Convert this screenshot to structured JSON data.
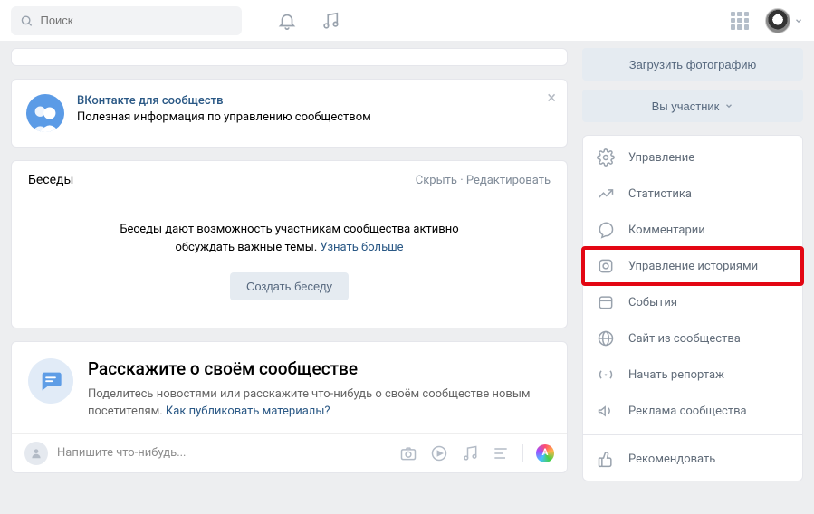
{
  "header": {
    "search_placeholder": "Поиск"
  },
  "info": {
    "title": "ВКонтакте для сообществ",
    "desc": "Полезная информация по управлению сообществом"
  },
  "chats": {
    "title": "Беседы",
    "hide": "Скрыть",
    "edit": "Редактировать",
    "body_line1": "Беседы дают возможность участникам сообщества активно",
    "body_line2": "обсуждать важные темы.",
    "learn_more": "Узнать больше",
    "create": "Создать беседу"
  },
  "about": {
    "title": "Расскажите о своём сообществе",
    "desc1": "Поделитесь новостями или расскажите что-нибудь о своём сообществе новым посетителям. ",
    "link": "Как публиковать материалы?"
  },
  "composer": {
    "placeholder": "Напишите что-нибудь...",
    "ai_label": "A"
  },
  "side": {
    "upload": "Загрузить фотографию",
    "member": "Вы участник",
    "menu": [
      {
        "label": "Управление"
      },
      {
        "label": "Статистика"
      },
      {
        "label": "Комментарии"
      },
      {
        "label": "Управление историями"
      },
      {
        "label": "События"
      },
      {
        "label": "Сайт из сообщества"
      },
      {
        "label": "Начать репортаж"
      },
      {
        "label": "Реклама сообщества"
      },
      {
        "label": "Рекомендовать"
      }
    ]
  }
}
